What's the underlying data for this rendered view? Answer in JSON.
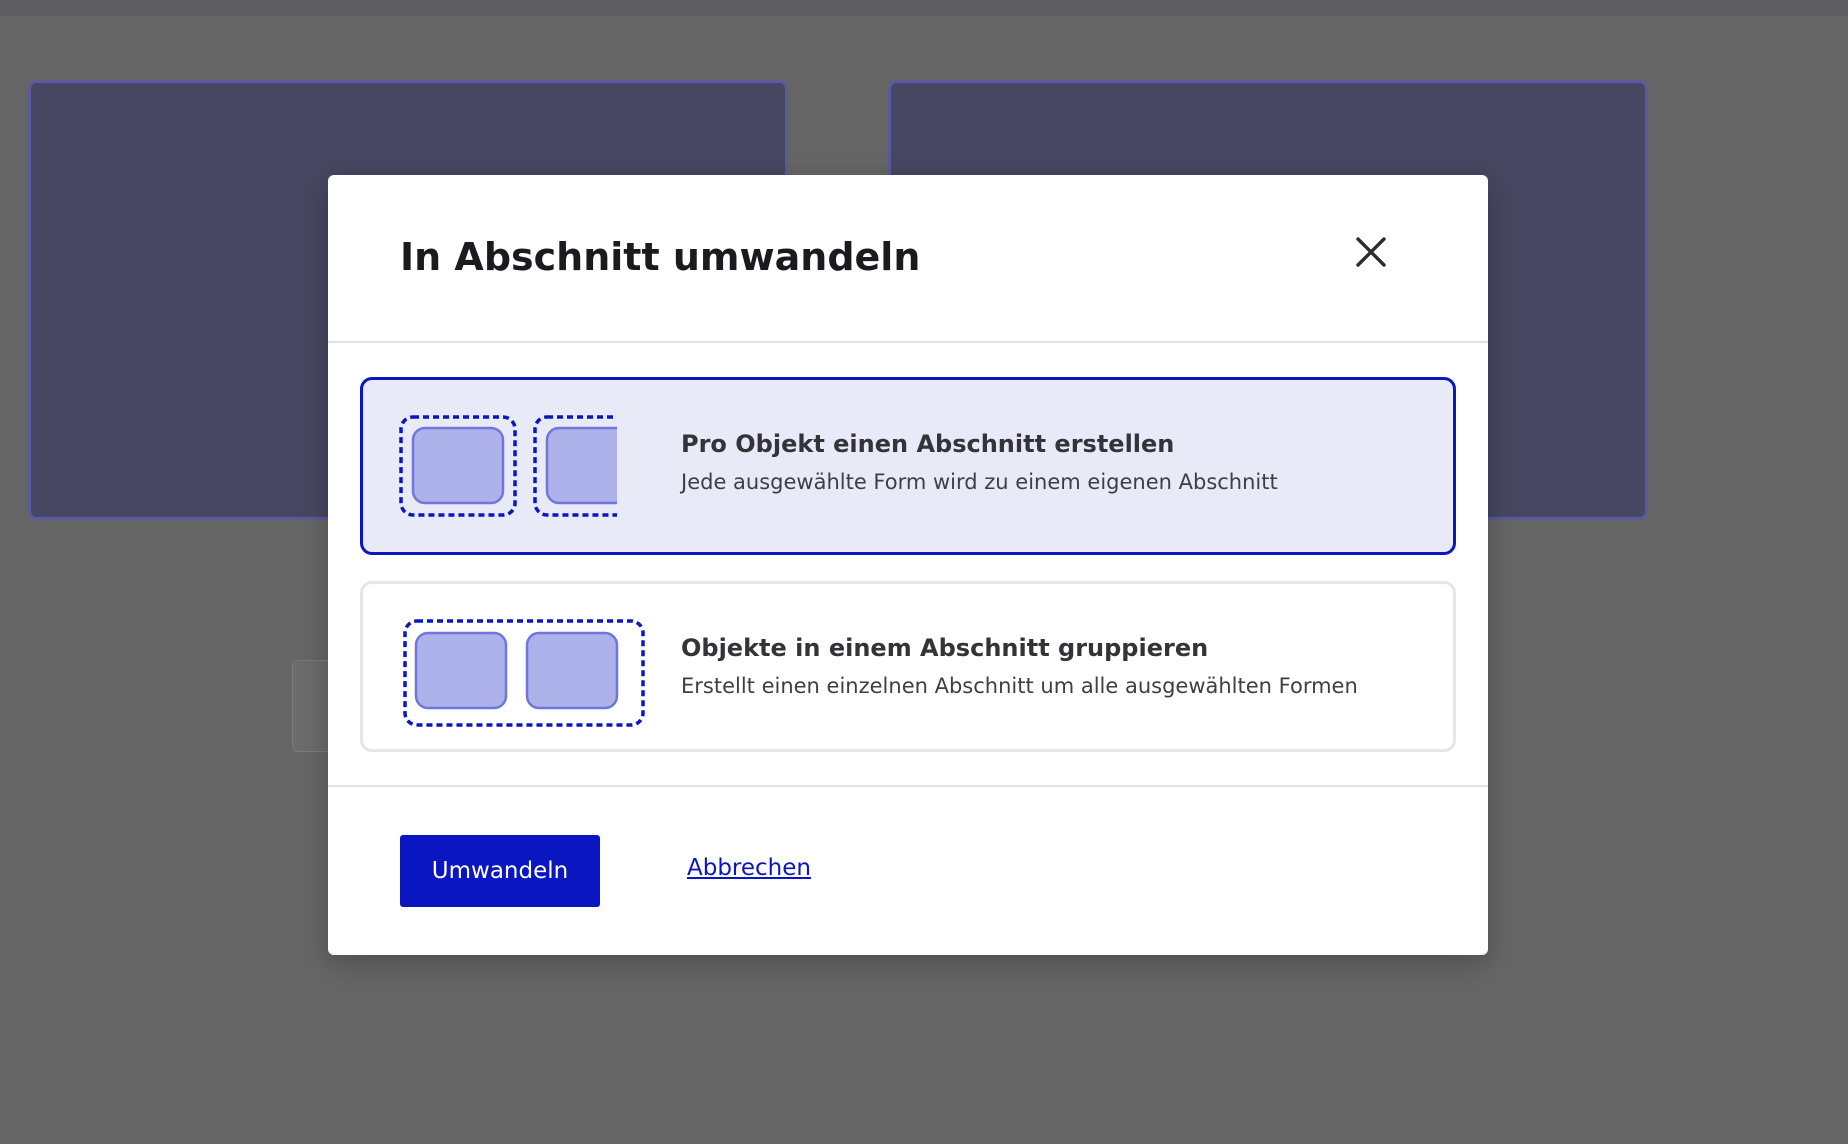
{
  "dialog": {
    "title": "In Abschnitt umwandeln",
    "close_icon": "close-icon",
    "options": [
      {
        "title": "Pro Objekt einen Abschnitt erstellen",
        "description": "Jede ausgewählte Form wird zu einem eigenen Abschnitt",
        "selected": true,
        "icon": "per-object-sections-icon"
      },
      {
        "title": "Objekte in einem Abschnitt gruppieren",
        "description": "Erstellt einen einzelnen Abschnitt um alle ausgewählten Formen",
        "selected": false,
        "icon": "group-in-section-icon"
      }
    ],
    "primary_label": "Umwandeln",
    "cancel_label": "Abbrechen"
  },
  "colors": {
    "accent": "#0a16c2",
    "selected_bg": "#e9eaf7",
    "shape_fill": "#aeb2ea",
    "shape_stroke": "#6f76dc",
    "overlay": "#666666"
  }
}
